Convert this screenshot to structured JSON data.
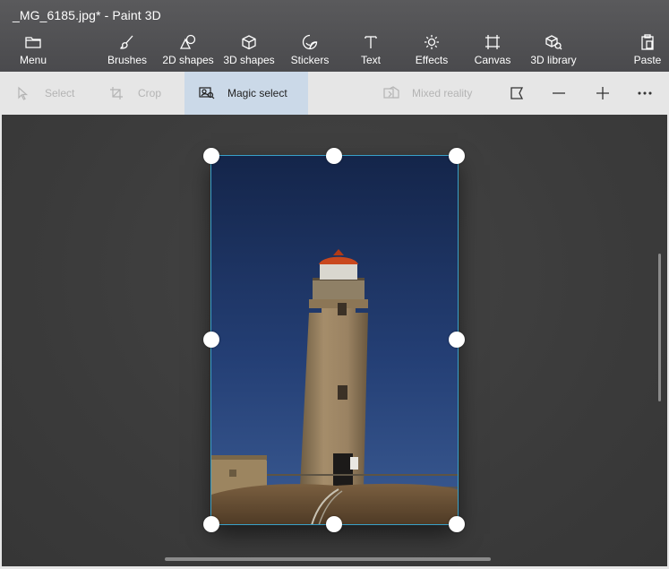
{
  "window": {
    "title": "_MG_6185.jpg* - Paint 3D"
  },
  "toolbar": {
    "menu": {
      "label": "Menu",
      "icon": "folder-icon"
    },
    "items": [
      {
        "label": "Brushes",
        "icon": "brush-icon"
      },
      {
        "label": "2D shapes",
        "icon": "2d-shapes-icon"
      },
      {
        "label": "3D shapes",
        "icon": "3d-cube-icon"
      },
      {
        "label": "Stickers",
        "icon": "sticker-icon"
      },
      {
        "label": "Text",
        "icon": "text-icon"
      },
      {
        "label": "Effects",
        "icon": "sun-icon"
      },
      {
        "label": "Canvas",
        "icon": "canvas-icon"
      },
      {
        "label": "3D library",
        "icon": "3d-library-icon"
      }
    ],
    "paste": {
      "label": "Paste",
      "icon": "clipboard-icon"
    }
  },
  "subtoolbar": {
    "select": {
      "label": "Select",
      "enabled": false
    },
    "crop": {
      "label": "Crop",
      "enabled": false
    },
    "magic_select": {
      "label": "Magic select",
      "active": true
    },
    "mixed_reality": {
      "label": "Mixed reality",
      "enabled": false
    }
  },
  "colors": {
    "titlebar": "#4e4e51",
    "subbar": "#e6e6e6",
    "active_tool": "#cbd9e8",
    "workspace": "#3c3c3c",
    "selection_border": "#39a0c8"
  }
}
